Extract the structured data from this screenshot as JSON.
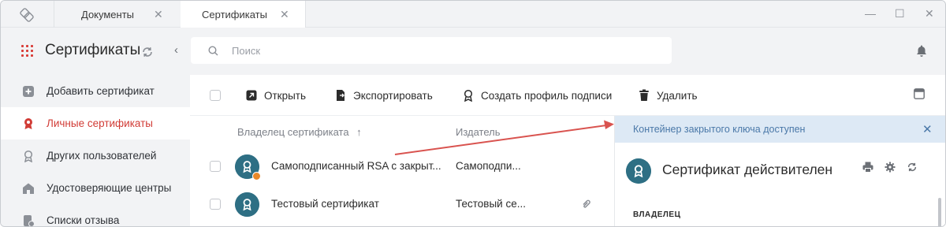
{
  "tabs": [
    {
      "label": "Документы",
      "close": "✕"
    },
    {
      "label": "Сертификаты",
      "close": "✕"
    }
  ],
  "window_controls": {
    "minimize": "—",
    "maximize": "☐",
    "close": "✕"
  },
  "sidebar": {
    "title": "Сертификаты",
    "items": [
      {
        "label": "Добавить сертификат",
        "icon": "plus-square-icon"
      },
      {
        "label": "Личные сертификаты",
        "icon": "certificate-badge-icon",
        "active": true
      },
      {
        "label": "Других пользователей",
        "icon": "certificate-outline-icon"
      },
      {
        "label": "Удостоверяющие центры",
        "icon": "building-icon"
      },
      {
        "label": "Списки отзыва",
        "icon": "revocation-list-icon"
      }
    ]
  },
  "search": {
    "placeholder": "Поиск",
    "value": ""
  },
  "toolbar": {
    "open_label": "Открыть",
    "export_label": "Экспортировать",
    "create_profile_label": "Создать профиль подписи",
    "delete_label": "Удалить"
  },
  "table": {
    "columns": {
      "owner": "Владелец сертификата",
      "sort_indicator": "↑",
      "issuer": "Издатель"
    },
    "rows": [
      {
        "owner": "Самоподписанный RSA с закрыт...",
        "issuer": "Самоподпи...",
        "warning": true
      },
      {
        "owner": "Тестовый сертификат",
        "issuer": "Тестовый се...",
        "attachment": true
      }
    ]
  },
  "details": {
    "notice": "Контейнер закрытого ключа доступен",
    "status_title": "Сертификат действителен",
    "owner_section_label": "ВЛАДЕЛЕЦ"
  },
  "colors": {
    "accent_red": "#d13c36",
    "avatar_teal": "#2e6f84",
    "notice_bg": "#dde9f5",
    "notice_text": "#4a78a8",
    "warning_orange": "#e8882a",
    "annotation_arrow": "#d9534f"
  }
}
